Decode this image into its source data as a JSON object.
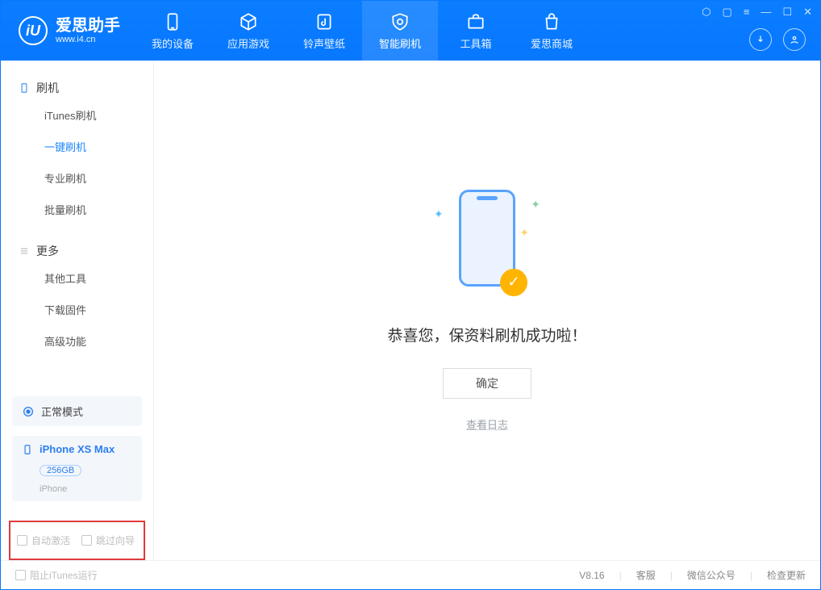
{
  "app": {
    "name_cn": "爱思助手",
    "name_en": "www.i4.cn",
    "logo_letter": "iU"
  },
  "nav": {
    "items": [
      {
        "label": "我的设备"
      },
      {
        "label": "应用游戏"
      },
      {
        "label": "铃声壁纸"
      },
      {
        "label": "智能刷机"
      },
      {
        "label": "工具箱"
      },
      {
        "label": "爱思商城"
      }
    ],
    "active_index": 3
  },
  "sidebar": {
    "group1": "刷机",
    "items1": [
      {
        "label": "iTunes刷机"
      },
      {
        "label": "一键刷机"
      },
      {
        "label": "专业刷机"
      },
      {
        "label": "批量刷机"
      }
    ],
    "active1_index": 1,
    "group2": "更多",
    "items2": [
      {
        "label": "其他工具"
      },
      {
        "label": "下载固件"
      },
      {
        "label": "高级功能"
      }
    ]
  },
  "device": {
    "mode_label": "正常模式",
    "name": "iPhone XS Max",
    "capacity": "256GB",
    "type": "iPhone"
  },
  "options": {
    "auto_activate": "自动激活",
    "skip_guide": "跳过向导"
  },
  "main": {
    "success_text": "恭喜您，保资料刷机成功啦！",
    "ok_button": "确定",
    "view_log": "查看日志",
    "check_icon": "✓"
  },
  "status": {
    "block_itunes": "阻止iTunes运行",
    "version": "V8.16",
    "support": "客服",
    "wechat": "微信公众号",
    "check_update": "检查更新"
  }
}
